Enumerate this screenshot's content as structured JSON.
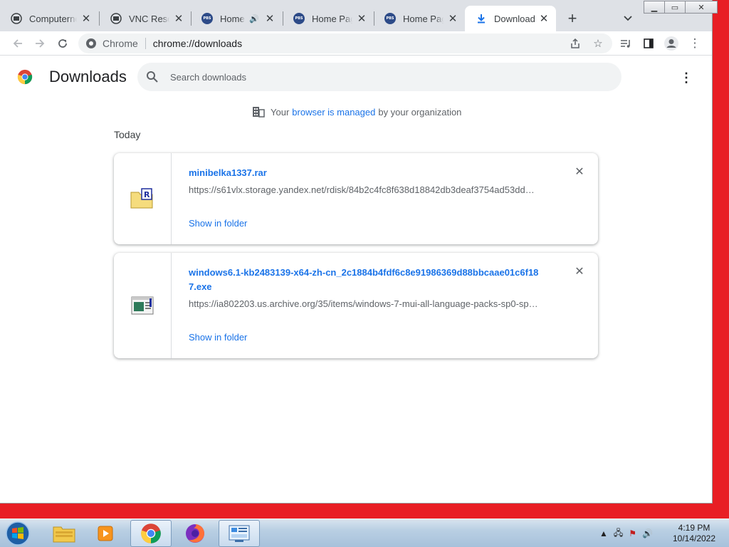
{
  "browser": {
    "tabs": [
      {
        "title": "Computernewb",
        "icon": "vm-icon"
      },
      {
        "title": "VNC Resolver",
        "icon": "vm-icon"
      },
      {
        "title": "Home Page",
        "icon": "pbs-icon"
      },
      {
        "title": "Home Page",
        "icon": "pbs-icon"
      },
      {
        "title": "Home Page",
        "icon": "pbs-icon"
      },
      {
        "title": "Downloads",
        "icon": "download-icon"
      }
    ],
    "active_tab": 5,
    "pbs_label": "PBS",
    "window_buttons": {
      "minimize": "▁",
      "maximize": "▭",
      "close": "✕"
    },
    "omnibox": {
      "chip": "Chrome",
      "url": "chrome://downloads"
    }
  },
  "page": {
    "title": "Downloads",
    "search_placeholder": "Search downloads",
    "managed": {
      "prefix": "Your",
      "link": "browser is managed",
      "suffix": "by your organization"
    },
    "date_heading": "Today",
    "downloads": [
      {
        "file_name": "minibelka1337.rar",
        "url": "https://s61vlx.storage.yandex.net/rdisk/84b2c4fc8f638d18842db3deaf3754ad53dd…",
        "action": "Show in folder",
        "icon": "rar-archive-icon"
      },
      {
        "file_name": "windows6.1-kb2483139-x64-zh-cn_2c1884b4fdf6c8e91986369d88bbcaae01c6f187.exe",
        "url": "https://ia802203.us.archive.org/35/items/windows-7-mui-all-language-packs-sp0-sp…",
        "action": "Show in folder",
        "icon": "exe-installer-icon"
      }
    ]
  },
  "taskbar": {
    "items": [
      "windows-explorer",
      "media-player",
      "chrome",
      "firefox",
      "control-panel"
    ],
    "active_item": "chrome",
    "clock": {
      "time": "4:19 PM",
      "date": "10/14/2022"
    },
    "colors": {
      "desktop": "#e81e24",
      "link": "#1a73e8"
    }
  }
}
